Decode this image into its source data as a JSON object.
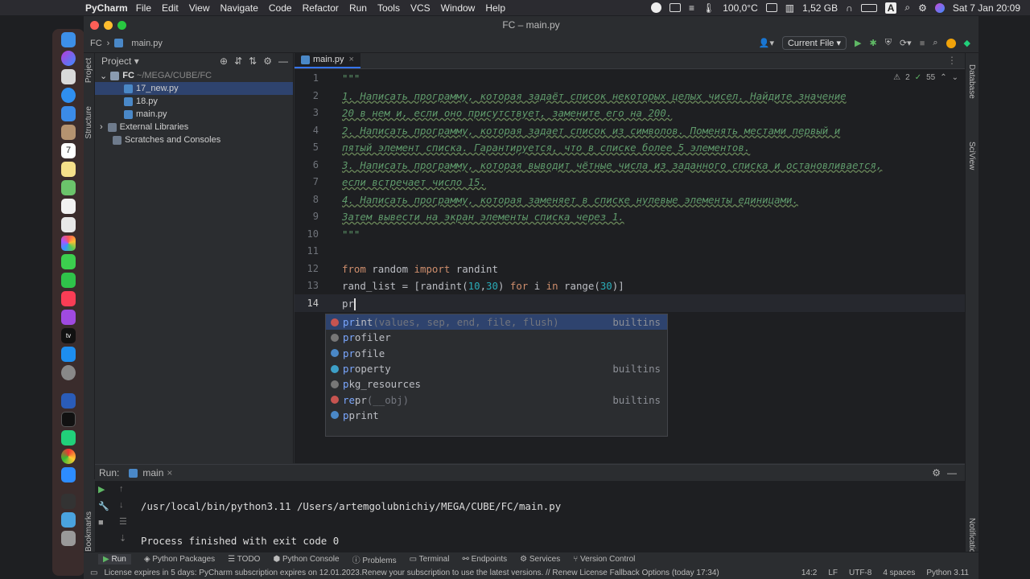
{
  "menubar": {
    "app": "PyCharm",
    "items": [
      "File",
      "Edit",
      "View",
      "Navigate",
      "Code",
      "Refactor",
      "Run",
      "Tools",
      "VCS",
      "Window",
      "Help"
    ],
    "temperature": "100,0°C",
    "memory": "1,52 GB",
    "datetime": "Sat 7 Jan  20:09"
  },
  "window": {
    "title": "FC – main.py",
    "breadcrumb_project": "FC",
    "breadcrumb_file": "main.py",
    "run_config": "Current File"
  },
  "project": {
    "header": "Project",
    "root": "FC",
    "root_path": "~/MEGA/CUBE/FC",
    "files": [
      "17_new.py",
      "18.py",
      "main.py"
    ],
    "external": "External Libraries",
    "scratches": "Scratches and Consoles"
  },
  "side_labels": {
    "project": "Project",
    "structure": "Structure",
    "bookmarks": "Bookmarks",
    "database": "Database",
    "sciview": "SciView",
    "notifications": "Notifications"
  },
  "editor": {
    "tab": "main.py",
    "warnings": "2",
    "typos": "55",
    "line_numbers": [
      "1",
      "2",
      "3",
      "4",
      "5",
      "6",
      "7",
      "8",
      "9",
      "10",
      "11",
      "12",
      "13",
      "14"
    ],
    "doc_open": "\"\"\"",
    "doc_lines": [
      "1. Написать программу, которая задаёт список некоторых целых чисел. Найдите значение",
      "20 в нем и, если оно присутствует, замените его на 200.",
      "2. Написать программу, которая задает список из символов. Поменять местами первый и",
      "пятый элемент списка. Гарантируется, что в списке более 5 элементов.",
      "3. Написать программу, которая выводит чётные числа из заданного списка и остановливается,",
      "если встречает число 15.",
      "4. Написать программу, которая заменяет в списке нулевые элементы единицами.",
      "Затем вывести на экран элементы списка через 1."
    ],
    "doc_close": "\"\"\"",
    "line12": {
      "kw1": "from",
      "mod": " random ",
      "kw2": "import",
      "name": " randint"
    },
    "line13": {
      "a": "rand_list = [randint(",
      "n1": "10",
      "c": ",",
      "n2": "30",
      "b": ") ",
      "kw": "for",
      "i": " i ",
      "kw2": "in",
      "r": " range(",
      "n3": "30",
      "e": ")]"
    },
    "line14": "pr"
  },
  "completion": [
    {
      "match": "pr",
      "rest": "int",
      "sig": "(values, sep, end, file, flush)",
      "src": "builtins",
      "icon": "#c75450"
    },
    {
      "match": "pr",
      "rest": "ofiler",
      "sig": "",
      "src": "",
      "icon": "#777777"
    },
    {
      "match": "pr",
      "rest": "ofile",
      "sig": "",
      "src": "",
      "icon": "#4a88c7"
    },
    {
      "match": "pr",
      "rest": "operty",
      "sig": "",
      "src": "builtins",
      "icon": "#3d9fc7"
    },
    {
      "match": "p",
      "rest": "kg_resources",
      "sig": "",
      "src": "",
      "icon": "#777777"
    },
    {
      "match": "re",
      "rest": "pr",
      "sig": "(__obj)",
      "src": "builtins",
      "icon": "#c75450"
    },
    {
      "match": "p",
      "rest": "print",
      "sig": "",
      "src": "",
      "icon": "#4a88c7"
    }
  ],
  "run": {
    "label": "Run:",
    "config": "main",
    "command": "/usr/local/bin/python3.11 /Users/artemgolubnichiy/MEGA/CUBE/FC/main.py",
    "exit": "Process finished with exit code 0"
  },
  "bottom_tabs": [
    "Run",
    "Python Packages",
    "TODO",
    "Python Console",
    "Problems",
    "Terminal",
    "Endpoints",
    "Services",
    "Version Control"
  ],
  "status": {
    "license": "License expires in 5 days: PyCharm subscription expires on 12.01.2023.Renew your subscription to use the latest versions. // Renew License   Fallback Options (today 17:34)",
    "pos": "14:2",
    "eol": "LF",
    "enc": "UTF-8",
    "indent": "4 spaces",
    "interp": "Python 3.11"
  }
}
